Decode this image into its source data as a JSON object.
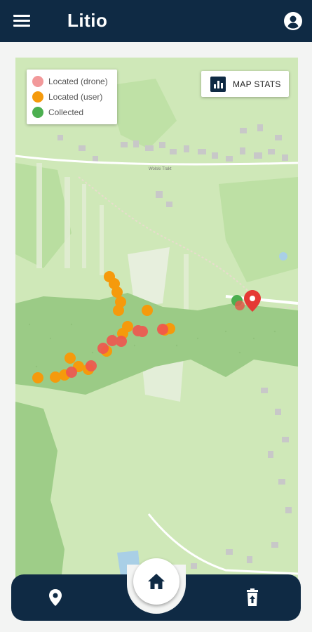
{
  "app": {
    "title": "Litio",
    "brand_color": "#0f2a44"
  },
  "header": {
    "menu_icon": "hamburger-menu-icon",
    "account_icon": "account-circle-icon"
  },
  "legend": {
    "items": [
      {
        "label": "Located (drone)",
        "color": "#f2999a"
      },
      {
        "label": "Located (user)",
        "color": "#f59a0c"
      },
      {
        "label": "Collected",
        "color": "#4caf50"
      }
    ]
  },
  "map_stats": {
    "label": "MAP STATS",
    "icon": "bar-chart-icon"
  },
  "map": {
    "road_label": "Wolski Trakt"
  },
  "bottom_nav": {
    "left_icon": "location-pin-icon",
    "center_icon": "home-icon",
    "right_icon": "delete-upload-icon"
  }
}
